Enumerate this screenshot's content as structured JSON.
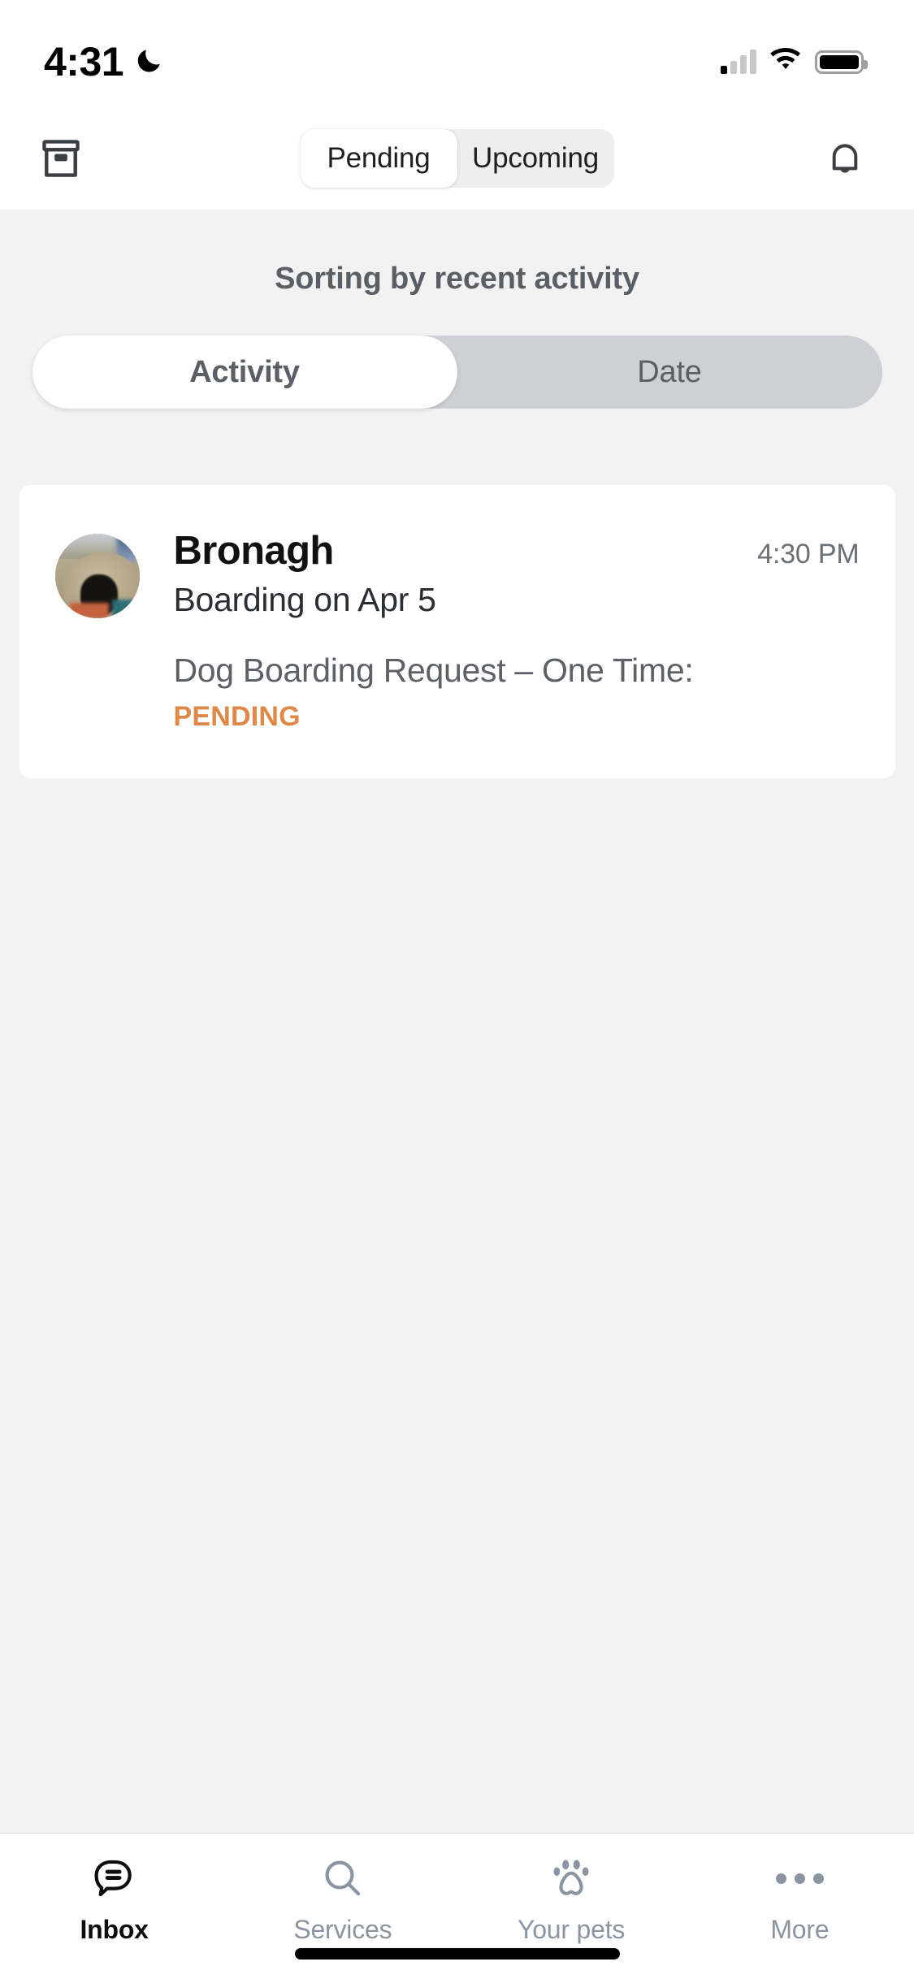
{
  "status_bar": {
    "time": "4:31",
    "dnd_icon": "moon-icon",
    "signal_icon": "cellular-signal-icon",
    "signal_bars_filled": 1,
    "signal_bars_total": 4,
    "wifi_icon": "wifi-icon",
    "battery_icon": "battery-icon"
  },
  "header": {
    "archive_icon": "archive-box-icon",
    "notifications_icon": "bell-icon",
    "tabs": [
      {
        "label": "Pending",
        "active": true
      },
      {
        "label": "Upcoming",
        "active": false
      }
    ]
  },
  "sort": {
    "label": "Sorting by recent activity",
    "options": [
      {
        "label": "Activity",
        "active": true
      },
      {
        "label": "Date",
        "active": false
      }
    ]
  },
  "conversations": [
    {
      "name": "Bronagh",
      "time": "4:30 PM",
      "subtitle": "Boarding on Apr 5",
      "request_title": "Dog Boarding Request – One Time:",
      "status": "PENDING",
      "status_color": "#e08847",
      "avatar_icon": "dog-photo-avatar"
    }
  ],
  "tab_bar": [
    {
      "label": "Inbox",
      "icon": "chat-bubble-icon",
      "active": true
    },
    {
      "label": "Services",
      "icon": "search-icon",
      "active": false
    },
    {
      "label": "Your pets",
      "icon": "paw-print-icon",
      "active": false
    },
    {
      "label": "More",
      "icon": "ellipsis-icon",
      "active": false
    }
  ],
  "colors": {
    "background": "#f2f2f2",
    "card": "#ffffff",
    "accent_pending": "#e08847",
    "inactive_tab": "#8b95a1",
    "toggle_track": "#cdd1d6"
  }
}
